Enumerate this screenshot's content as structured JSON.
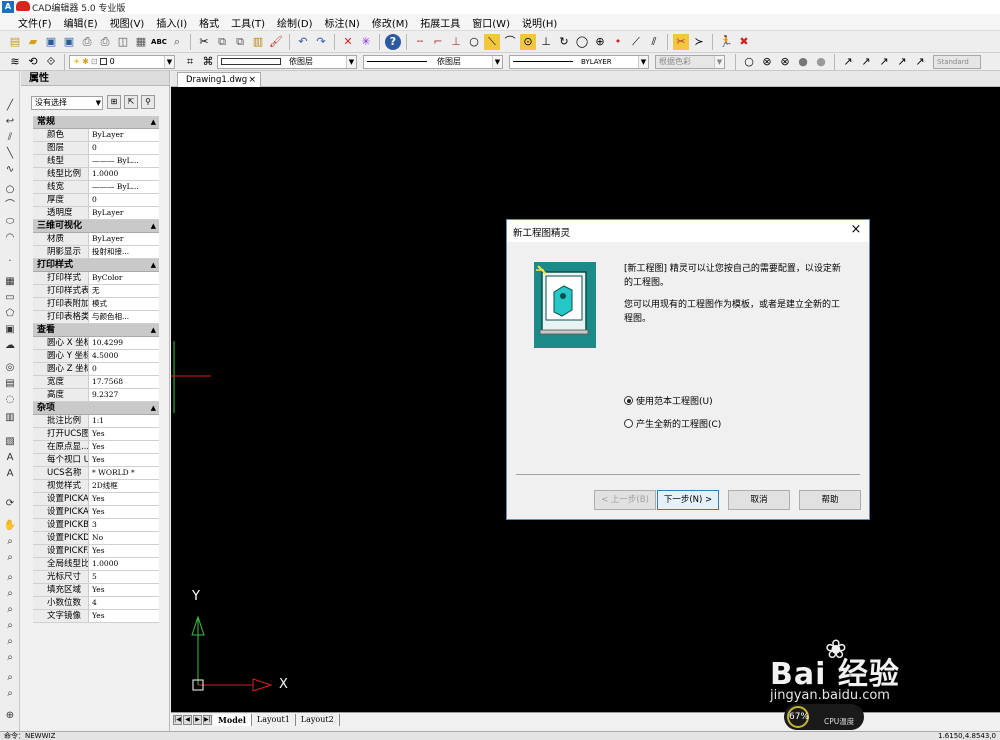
{
  "app": {
    "title": "CAD编辑器 5.0 专业版",
    "logo_letter": "A"
  },
  "menu": [
    {
      "label": "文件(F)"
    },
    {
      "label": "编辑(E)"
    },
    {
      "label": "视图(V)"
    },
    {
      "label": "插入(I)"
    },
    {
      "label": "格式"
    },
    {
      "label": "工具(T)"
    },
    {
      "label": "绘制(D)"
    },
    {
      "label": "标注(N)"
    },
    {
      "label": "修改(M)"
    },
    {
      "label": "拓展工具"
    },
    {
      "label": "窗口(W)"
    },
    {
      "label": "说明(H)"
    }
  ],
  "layer_toolbar": {
    "layer_value": "0",
    "color_value": "依图层",
    "linetype_value": "依图层",
    "lineweight_value": "BYLAYER",
    "plotstyle_value": "根据色彩",
    "textstyle_value": "Standard"
  },
  "properties": {
    "title": "属性",
    "selection": "没有选择",
    "categories": [
      {
        "name": "常规",
        "rows": [
          {
            "key": "颜色",
            "value": "ByLayer"
          },
          {
            "key": "图层",
            "value": "0"
          },
          {
            "key": "线型",
            "value": "——— ByL..."
          },
          {
            "key": "线型比例",
            "value": "1.0000"
          },
          {
            "key": "线宽",
            "value": "——— ByL..."
          },
          {
            "key": "厚度",
            "value": "0"
          },
          {
            "key": "透明度",
            "value": "ByLayer"
          }
        ]
      },
      {
        "name": "三维可视化",
        "rows": [
          {
            "key": "材质",
            "value": "ByLayer"
          },
          {
            "key": "阴影显示",
            "value": "投射和接..."
          }
        ]
      },
      {
        "name": "打印样式",
        "rows": [
          {
            "key": "打印样式",
            "value": "ByColor"
          },
          {
            "key": "打印样式表",
            "value": "无"
          },
          {
            "key": "打印表附加到",
            "value": "模式"
          },
          {
            "key": "打印表格类型",
            "value": "与颜色相..."
          }
        ]
      },
      {
        "name": "查看",
        "rows": [
          {
            "key": "圆心 X 坐标",
            "value": "10.4299"
          },
          {
            "key": "圆心 Y 坐标",
            "value": "4.5000"
          },
          {
            "key": "圆心 Z 坐标",
            "value": "0"
          },
          {
            "key": "宽度",
            "value": "17.7568"
          },
          {
            "key": "高度",
            "value": "9.2327"
          }
        ]
      },
      {
        "name": "杂项",
        "rows": [
          {
            "key": "批注比例",
            "value": "1:1"
          },
          {
            "key": "打开UCS图标",
            "value": "Yes"
          },
          {
            "key": "在原点显...",
            "value": "Yes"
          },
          {
            "key": "每个视口 UCS",
            "value": "Yes"
          },
          {
            "key": "UCS名称",
            "value": "* WORLD *"
          },
          {
            "key": "视觉样式",
            "value": "2D线框"
          },
          {
            "key": "设置PICKADD",
            "value": "Yes"
          },
          {
            "key": "设置PICKAUTO",
            "value": "Yes"
          },
          {
            "key": "设置PICKBOX",
            "value": "3"
          },
          {
            "key": "设置PICKDRAG",
            "value": "No"
          },
          {
            "key": "设置PICKF...",
            "value": "Yes"
          },
          {
            "key": "全局线型比例",
            "value": "1.0000"
          },
          {
            "key": "光标尺寸",
            "value": "5"
          },
          {
            "key": "填充区域",
            "value": "Yes"
          },
          {
            "key": "小数位数",
            "value": "4"
          },
          {
            "key": "文字镜像",
            "value": "Yes"
          }
        ]
      }
    ]
  },
  "document_tab": {
    "label": "Drawing1.dwg",
    "close": "×"
  },
  "canvas": {
    "axis_x": "X",
    "axis_y": "Y"
  },
  "layout_tabs": [
    {
      "label": "Model",
      "active": true
    },
    {
      "label": "Layout1",
      "active": false
    },
    {
      "label": "Layout2",
      "active": false
    }
  ],
  "status": {
    "command_label": "命令：NEWWIZ",
    "coordinates": "1.6150,4.8543,0"
  },
  "dialog": {
    "title": "新工程图精灵",
    "close": "×",
    "paragraph1": "[新工程图] 精灵可以让您按自己的需要配置，以设定新的工程图。",
    "paragraph2": "您可以用现有的工程图作为模板，或者是建立全新的工程图。",
    "option1": "使用范本工程图(U)",
    "option2": "产生全新的工程图(C)",
    "selected_option": 1,
    "buttons": {
      "back": "< 上一步(B)",
      "next": "下一步(N) >",
      "cancel": "取消",
      "help": "帮助"
    }
  },
  "watermark": {
    "brand": "Bai  经验",
    "site": "jingyan.baidu.com"
  },
  "cpu_widget": {
    "value": "67%",
    "label": "CPU温度"
  },
  "colors": {
    "canvas_bg": "#000000",
    "dialog_art": "#1d8a8a",
    "ucs_y_axis": "#3bbf3b",
    "ucs_x_axis": "#d42020"
  }
}
